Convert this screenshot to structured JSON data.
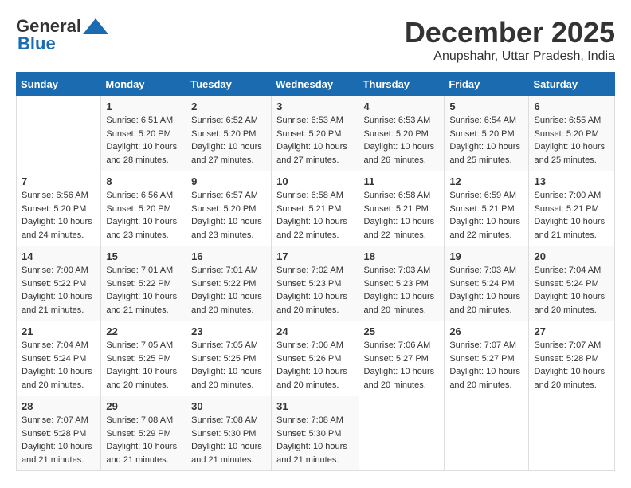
{
  "logo": {
    "part1": "General",
    "part2": "Blue"
  },
  "header": {
    "month": "December 2025",
    "location": "Anupshahr, Uttar Pradesh, India"
  },
  "weekdays": [
    "Sunday",
    "Monday",
    "Tuesday",
    "Wednesday",
    "Thursday",
    "Friday",
    "Saturday"
  ],
  "weeks": [
    [
      {
        "day": "",
        "sunrise": "",
        "sunset": "",
        "daylight": ""
      },
      {
        "day": "1",
        "sunrise": "Sunrise: 6:51 AM",
        "sunset": "Sunset: 5:20 PM",
        "daylight": "Daylight: 10 hours and 28 minutes."
      },
      {
        "day": "2",
        "sunrise": "Sunrise: 6:52 AM",
        "sunset": "Sunset: 5:20 PM",
        "daylight": "Daylight: 10 hours and 27 minutes."
      },
      {
        "day": "3",
        "sunrise": "Sunrise: 6:53 AM",
        "sunset": "Sunset: 5:20 PM",
        "daylight": "Daylight: 10 hours and 27 minutes."
      },
      {
        "day": "4",
        "sunrise": "Sunrise: 6:53 AM",
        "sunset": "Sunset: 5:20 PM",
        "daylight": "Daylight: 10 hours and 26 minutes."
      },
      {
        "day": "5",
        "sunrise": "Sunrise: 6:54 AM",
        "sunset": "Sunset: 5:20 PM",
        "daylight": "Daylight: 10 hours and 25 minutes."
      },
      {
        "day": "6",
        "sunrise": "Sunrise: 6:55 AM",
        "sunset": "Sunset: 5:20 PM",
        "daylight": "Daylight: 10 hours and 25 minutes."
      }
    ],
    [
      {
        "day": "7",
        "sunrise": "Sunrise: 6:56 AM",
        "sunset": "Sunset: 5:20 PM",
        "daylight": "Daylight: 10 hours and 24 minutes."
      },
      {
        "day": "8",
        "sunrise": "Sunrise: 6:56 AM",
        "sunset": "Sunset: 5:20 PM",
        "daylight": "Daylight: 10 hours and 23 minutes."
      },
      {
        "day": "9",
        "sunrise": "Sunrise: 6:57 AM",
        "sunset": "Sunset: 5:20 PM",
        "daylight": "Daylight: 10 hours and 23 minutes."
      },
      {
        "day": "10",
        "sunrise": "Sunrise: 6:58 AM",
        "sunset": "Sunset: 5:21 PM",
        "daylight": "Daylight: 10 hours and 22 minutes."
      },
      {
        "day": "11",
        "sunrise": "Sunrise: 6:58 AM",
        "sunset": "Sunset: 5:21 PM",
        "daylight": "Daylight: 10 hours and 22 minutes."
      },
      {
        "day": "12",
        "sunrise": "Sunrise: 6:59 AM",
        "sunset": "Sunset: 5:21 PM",
        "daylight": "Daylight: 10 hours and 22 minutes."
      },
      {
        "day": "13",
        "sunrise": "Sunrise: 7:00 AM",
        "sunset": "Sunset: 5:21 PM",
        "daylight": "Daylight: 10 hours and 21 minutes."
      }
    ],
    [
      {
        "day": "14",
        "sunrise": "Sunrise: 7:00 AM",
        "sunset": "Sunset: 5:22 PM",
        "daylight": "Daylight: 10 hours and 21 minutes."
      },
      {
        "day": "15",
        "sunrise": "Sunrise: 7:01 AM",
        "sunset": "Sunset: 5:22 PM",
        "daylight": "Daylight: 10 hours and 21 minutes."
      },
      {
        "day": "16",
        "sunrise": "Sunrise: 7:01 AM",
        "sunset": "Sunset: 5:22 PM",
        "daylight": "Daylight: 10 hours and 20 minutes."
      },
      {
        "day": "17",
        "sunrise": "Sunrise: 7:02 AM",
        "sunset": "Sunset: 5:23 PM",
        "daylight": "Daylight: 10 hours and 20 minutes."
      },
      {
        "day": "18",
        "sunrise": "Sunrise: 7:03 AM",
        "sunset": "Sunset: 5:23 PM",
        "daylight": "Daylight: 10 hours and 20 minutes."
      },
      {
        "day": "19",
        "sunrise": "Sunrise: 7:03 AM",
        "sunset": "Sunset: 5:24 PM",
        "daylight": "Daylight: 10 hours and 20 minutes."
      },
      {
        "day": "20",
        "sunrise": "Sunrise: 7:04 AM",
        "sunset": "Sunset: 5:24 PM",
        "daylight": "Daylight: 10 hours and 20 minutes."
      }
    ],
    [
      {
        "day": "21",
        "sunrise": "Sunrise: 7:04 AM",
        "sunset": "Sunset: 5:24 PM",
        "daylight": "Daylight: 10 hours and 20 minutes."
      },
      {
        "day": "22",
        "sunrise": "Sunrise: 7:05 AM",
        "sunset": "Sunset: 5:25 PM",
        "daylight": "Daylight: 10 hours and 20 minutes."
      },
      {
        "day": "23",
        "sunrise": "Sunrise: 7:05 AM",
        "sunset": "Sunset: 5:25 PM",
        "daylight": "Daylight: 10 hours and 20 minutes."
      },
      {
        "day": "24",
        "sunrise": "Sunrise: 7:06 AM",
        "sunset": "Sunset: 5:26 PM",
        "daylight": "Daylight: 10 hours and 20 minutes."
      },
      {
        "day": "25",
        "sunrise": "Sunrise: 7:06 AM",
        "sunset": "Sunset: 5:27 PM",
        "daylight": "Daylight: 10 hours and 20 minutes."
      },
      {
        "day": "26",
        "sunrise": "Sunrise: 7:07 AM",
        "sunset": "Sunset: 5:27 PM",
        "daylight": "Daylight: 10 hours and 20 minutes."
      },
      {
        "day": "27",
        "sunrise": "Sunrise: 7:07 AM",
        "sunset": "Sunset: 5:28 PM",
        "daylight": "Daylight: 10 hours and 20 minutes."
      }
    ],
    [
      {
        "day": "28",
        "sunrise": "Sunrise: 7:07 AM",
        "sunset": "Sunset: 5:28 PM",
        "daylight": "Daylight: 10 hours and 21 minutes."
      },
      {
        "day": "29",
        "sunrise": "Sunrise: 7:08 AM",
        "sunset": "Sunset: 5:29 PM",
        "daylight": "Daylight: 10 hours and 21 minutes."
      },
      {
        "day": "30",
        "sunrise": "Sunrise: 7:08 AM",
        "sunset": "Sunset: 5:30 PM",
        "daylight": "Daylight: 10 hours and 21 minutes."
      },
      {
        "day": "31",
        "sunrise": "Sunrise: 7:08 AM",
        "sunset": "Sunset: 5:30 PM",
        "daylight": "Daylight: 10 hours and 21 minutes."
      },
      {
        "day": "",
        "sunrise": "",
        "sunset": "",
        "daylight": ""
      },
      {
        "day": "",
        "sunrise": "",
        "sunset": "",
        "daylight": ""
      },
      {
        "day": "",
        "sunrise": "",
        "sunset": "",
        "daylight": ""
      }
    ]
  ]
}
